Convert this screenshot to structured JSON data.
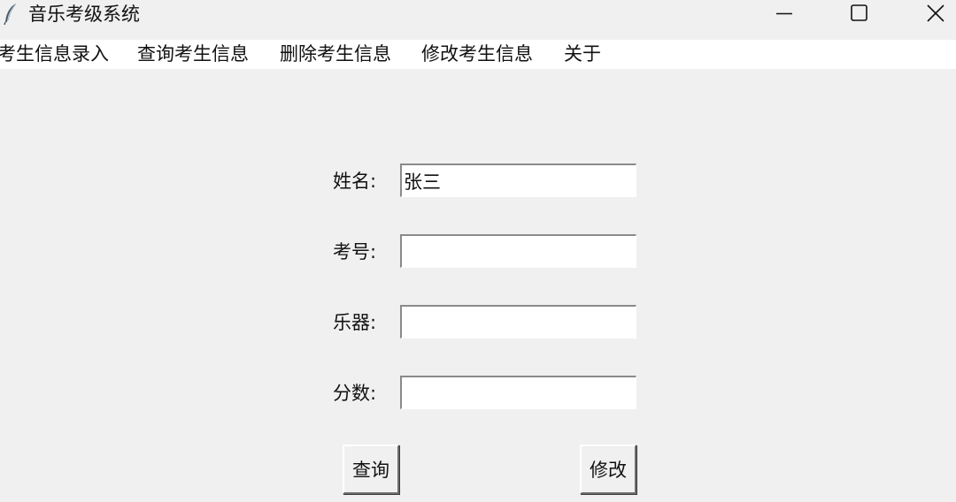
{
  "window": {
    "title": "音乐考级系统",
    "icon": "feather-icon",
    "controls": {
      "minimize_icon": "minimize-icon",
      "maximize_icon": "maximize-icon",
      "close_icon": "close-icon"
    }
  },
  "menu": {
    "items": [
      {
        "label": "考生信息录入"
      },
      {
        "label": "查询考生信息"
      },
      {
        "label": "删除考生信息"
      },
      {
        "label": "修改考生信息"
      },
      {
        "label": "关于"
      }
    ]
  },
  "form": {
    "fields": [
      {
        "label": "姓名:",
        "value": ""
      },
      {
        "label": "考号:",
        "value": ""
      },
      {
        "label": "乐器:",
        "value": ""
      },
      {
        "label": "分数:",
        "value": ""
      }
    ],
    "name_value": "张三",
    "query_button": "查询",
    "modify_button": "修改"
  },
  "colors": {
    "window_bg": "#f0f0f0",
    "menubar_bg": "#ffffff",
    "input_bg": "#ffffff",
    "text": "#111111"
  }
}
